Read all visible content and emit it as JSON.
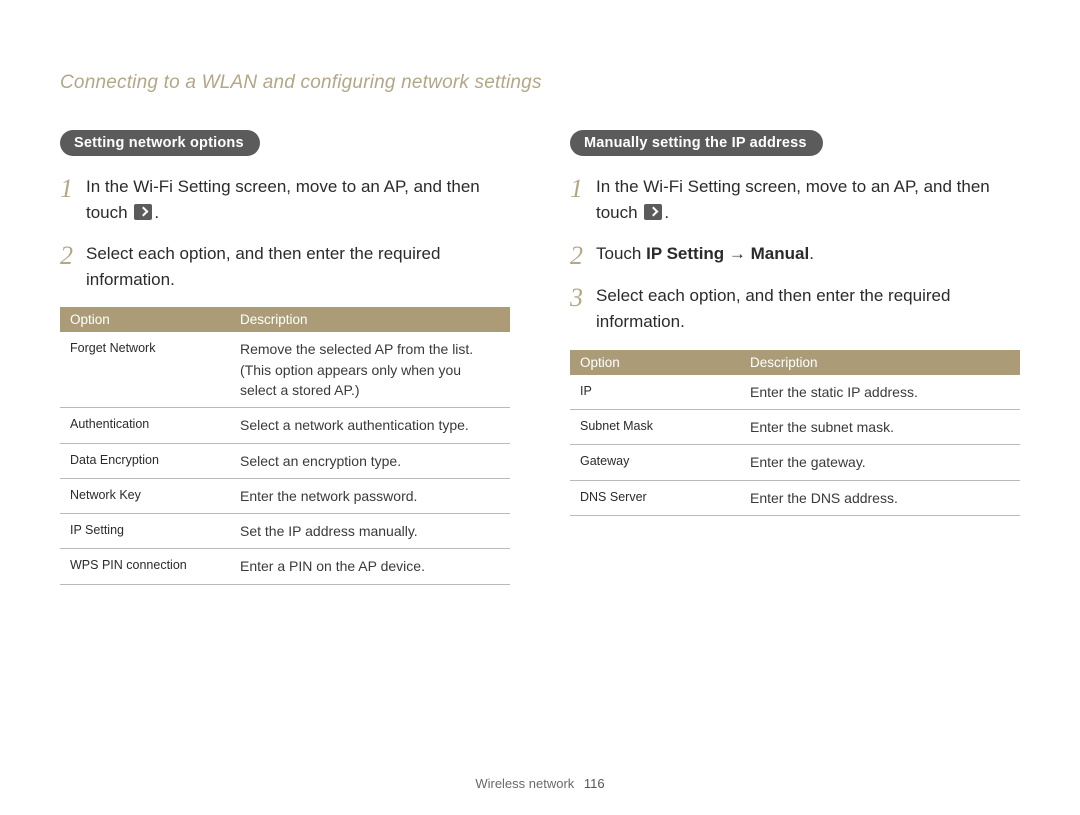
{
  "breadcrumb": "Connecting to a WLAN and configuring network settings",
  "left": {
    "heading": "Setting network options",
    "steps": [
      {
        "n": "1",
        "pre": "In the Wi-Fi Setting screen, move to an AP, and then touch ",
        "icon": true,
        "post": "."
      },
      {
        "n": "2",
        "pre": "Select each option, and then enter the required information.",
        "icon": false,
        "post": ""
      }
    ],
    "table": {
      "headers": [
        "Option",
        "Description"
      ],
      "rows": [
        [
          "Forget Network",
          "Remove the selected AP from the list. (This option appears only when you select a stored AP.)"
        ],
        [
          "Authentication",
          "Select a network authentication type."
        ],
        [
          "Data Encryption",
          "Select an encryption type."
        ],
        [
          "Network Key",
          "Enter the network password."
        ],
        [
          "IP Setting",
          "Set the IP address manually."
        ],
        [
          "WPS PIN connection",
          "Enter a PIN on the AP device."
        ]
      ]
    }
  },
  "right": {
    "heading": "Manually setting the IP address",
    "steps": [
      {
        "n": "1",
        "pre": "In the Wi-Fi Setting screen, move to an AP, and then touch ",
        "icon": true,
        "post": "."
      },
      {
        "n": "2",
        "pre": "Touch ",
        "bold1": "IP Setting",
        "mid": " → ",
        "bold2": "Manual",
        "post2": "."
      },
      {
        "n": "3",
        "pre": "Select each option, and then enter the required information.",
        "icon": false,
        "post": ""
      }
    ],
    "table": {
      "headers": [
        "Option",
        "Description"
      ],
      "rows": [
        [
          "IP",
          "Enter the static IP address."
        ],
        [
          "Subnet Mask",
          "Enter the subnet mask."
        ],
        [
          "Gateway",
          "Enter the gateway."
        ],
        [
          "DNS Server",
          "Enter the DNS address."
        ]
      ]
    }
  },
  "footer": {
    "section": "Wireless network",
    "page": "116"
  }
}
